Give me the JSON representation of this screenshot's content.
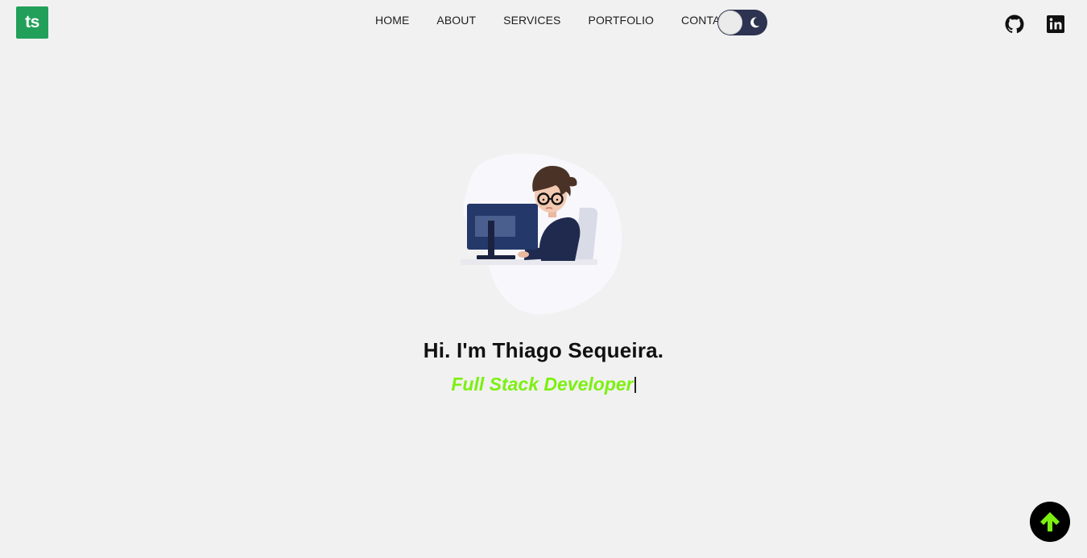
{
  "header": {
    "logo_text": "ts",
    "nav": [
      {
        "label": "HOME"
      },
      {
        "label": "ABOUT"
      },
      {
        "label": "SERVICES"
      },
      {
        "label": "PORTFOLIO"
      },
      {
        "label": "CONTACT"
      }
    ],
    "theme_toggle": {
      "icon": "moon-icon",
      "state": "light"
    },
    "social": [
      {
        "icon": "github-icon"
      },
      {
        "icon": "linkedin-icon"
      }
    ]
  },
  "hero": {
    "illustration": "developer-at-computer",
    "title": "Hi. I'm Thiago Sequeira.",
    "subtitle": "Full Stack Developer"
  },
  "scroll_top": {
    "icon": "arrow-up-icon"
  },
  "colors": {
    "background": "#f1f1f1",
    "logo": "#22a05a",
    "accent": "#7cf010",
    "toggle": "#2d3350",
    "scroll_button": "#000000"
  }
}
